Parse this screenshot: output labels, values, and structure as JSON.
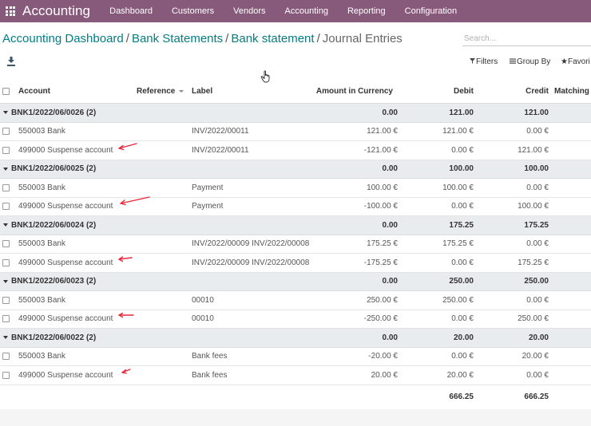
{
  "navbar": {
    "app_name": "Accounting",
    "menu": [
      "Dashboard",
      "Customers",
      "Vendors",
      "Accounting",
      "Reporting",
      "Configuration"
    ]
  },
  "breadcrumb": [
    "Accounting Dashboard",
    "Bank Statements",
    "Bank statement",
    "Journal Entries"
  ],
  "search": {
    "placeholder": "Search..."
  },
  "controls": {
    "filters": "Filters",
    "group_by": "Group By",
    "favorites": "Favori"
  },
  "table": {
    "columns": [
      "Account",
      "Reference",
      "Label",
      "Amount in Currency",
      "Debit",
      "Credit",
      "Matching"
    ],
    "groups": [
      {
        "name": "BNK1/2022/06/0026 (2)",
        "amount": "0.00",
        "debit": "121.00",
        "credit": "121.00",
        "rows": [
          {
            "account": "550003 Bank",
            "label": "INV/2022/00011",
            "amount": "121.00 €",
            "debit": "121.00 €",
            "credit": "0.00 €"
          },
          {
            "account": "499000 Suspense account",
            "label": "INV/2022/00011",
            "amount": "-121.00 €",
            "debit": "0.00 €",
            "credit": "121.00 €"
          }
        ]
      },
      {
        "name": "BNK1/2022/06/0025 (2)",
        "amount": "0.00",
        "debit": "100.00",
        "credit": "100.00",
        "rows": [
          {
            "account": "550003 Bank",
            "label": "Payment",
            "amount": "100.00 €",
            "debit": "100.00 €",
            "credit": "0.00 €"
          },
          {
            "account": "499000 Suspense account",
            "label": "Payment",
            "amount": "-100.00 €",
            "debit": "0.00 €",
            "credit": "100.00 €"
          }
        ]
      },
      {
        "name": "BNK1/2022/06/0024 (2)",
        "amount": "0.00",
        "debit": "175.25",
        "credit": "175.25",
        "rows": [
          {
            "account": "550003 Bank",
            "label": "INV/2022/00009 INV/2022/00008",
            "amount": "175.25 €",
            "debit": "175.25 €",
            "credit": "0.00 €"
          },
          {
            "account": "499000 Suspense account",
            "label": "INV/2022/00009 INV/2022/00008",
            "amount": "-175.25 €",
            "debit": "0.00 €",
            "credit": "175.25 €"
          }
        ]
      },
      {
        "name": "BNK1/2022/06/0023 (2)",
        "amount": "0.00",
        "debit": "250.00",
        "credit": "250.00",
        "rows": [
          {
            "account": "550003 Bank",
            "label": "00010",
            "amount": "250.00 €",
            "debit": "250.00 €",
            "credit": "0.00 €"
          },
          {
            "account": "499000 Suspense account",
            "label": "00010",
            "amount": "-250.00 €",
            "debit": "0.00 €",
            "credit": "250.00 €"
          }
        ]
      },
      {
        "name": "BNK1/2022/06/0022 (2)",
        "amount": "0.00",
        "debit": "20.00",
        "credit": "20.00",
        "rows": [
          {
            "account": "550003 Bank",
            "label": "Bank fees",
            "amount": "-20.00 €",
            "debit": "0.00 €",
            "credit": "20.00 €"
          },
          {
            "account": "499000 Suspense account",
            "label": "Bank fees",
            "amount": "20.00 €",
            "debit": "20.00 €",
            "credit": "0.00 €"
          }
        ]
      }
    ],
    "totals": {
      "debit": "666.25",
      "credit": "666.25"
    }
  },
  "colors": {
    "brand": "#875a7b",
    "link": "#017e84",
    "annotation_arrow": "#e8293b",
    "group_row": "#e9ecef"
  }
}
